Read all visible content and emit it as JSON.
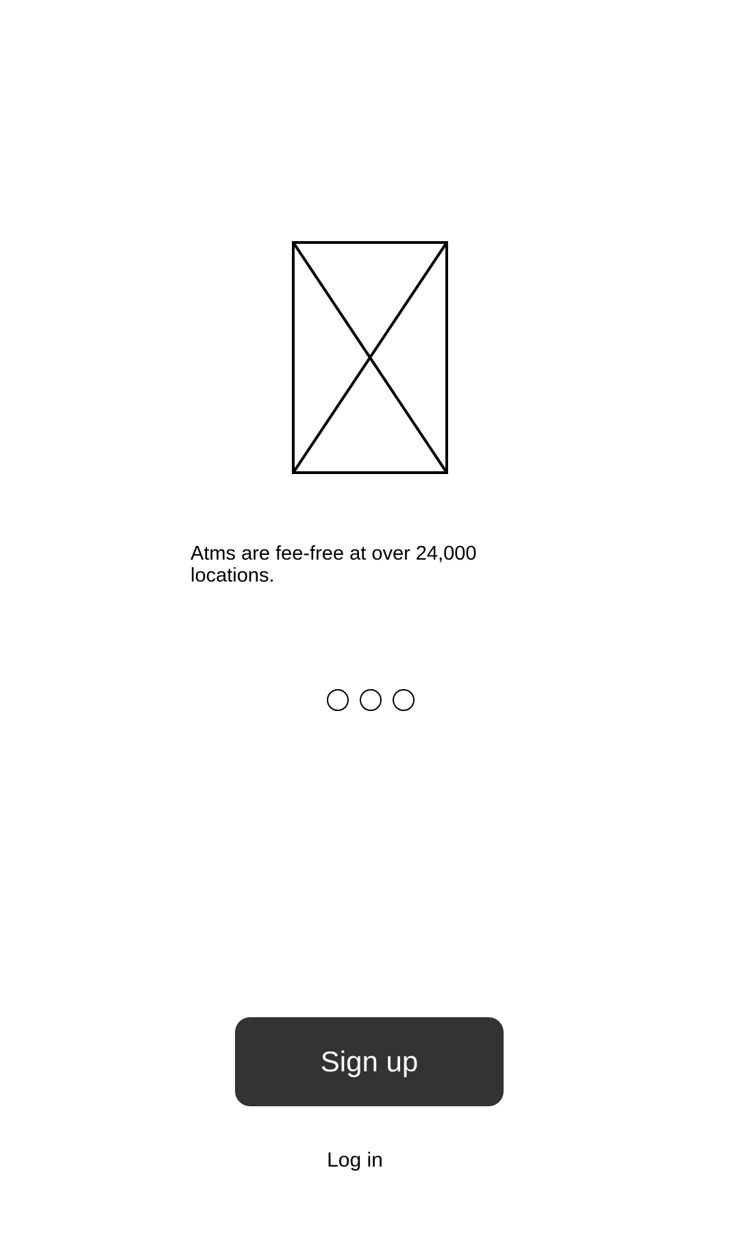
{
  "onboarding": {
    "image": {
      "icon": "image-placeholder-icon"
    },
    "caption": "Atms are fee-free at over 24,000 locations.",
    "pager": {
      "count": 3,
      "icon": "circle-outline-icon"
    }
  },
  "actions": {
    "signup_label": "Sign up",
    "signup_color": "#333333",
    "login_label": "Log in"
  }
}
